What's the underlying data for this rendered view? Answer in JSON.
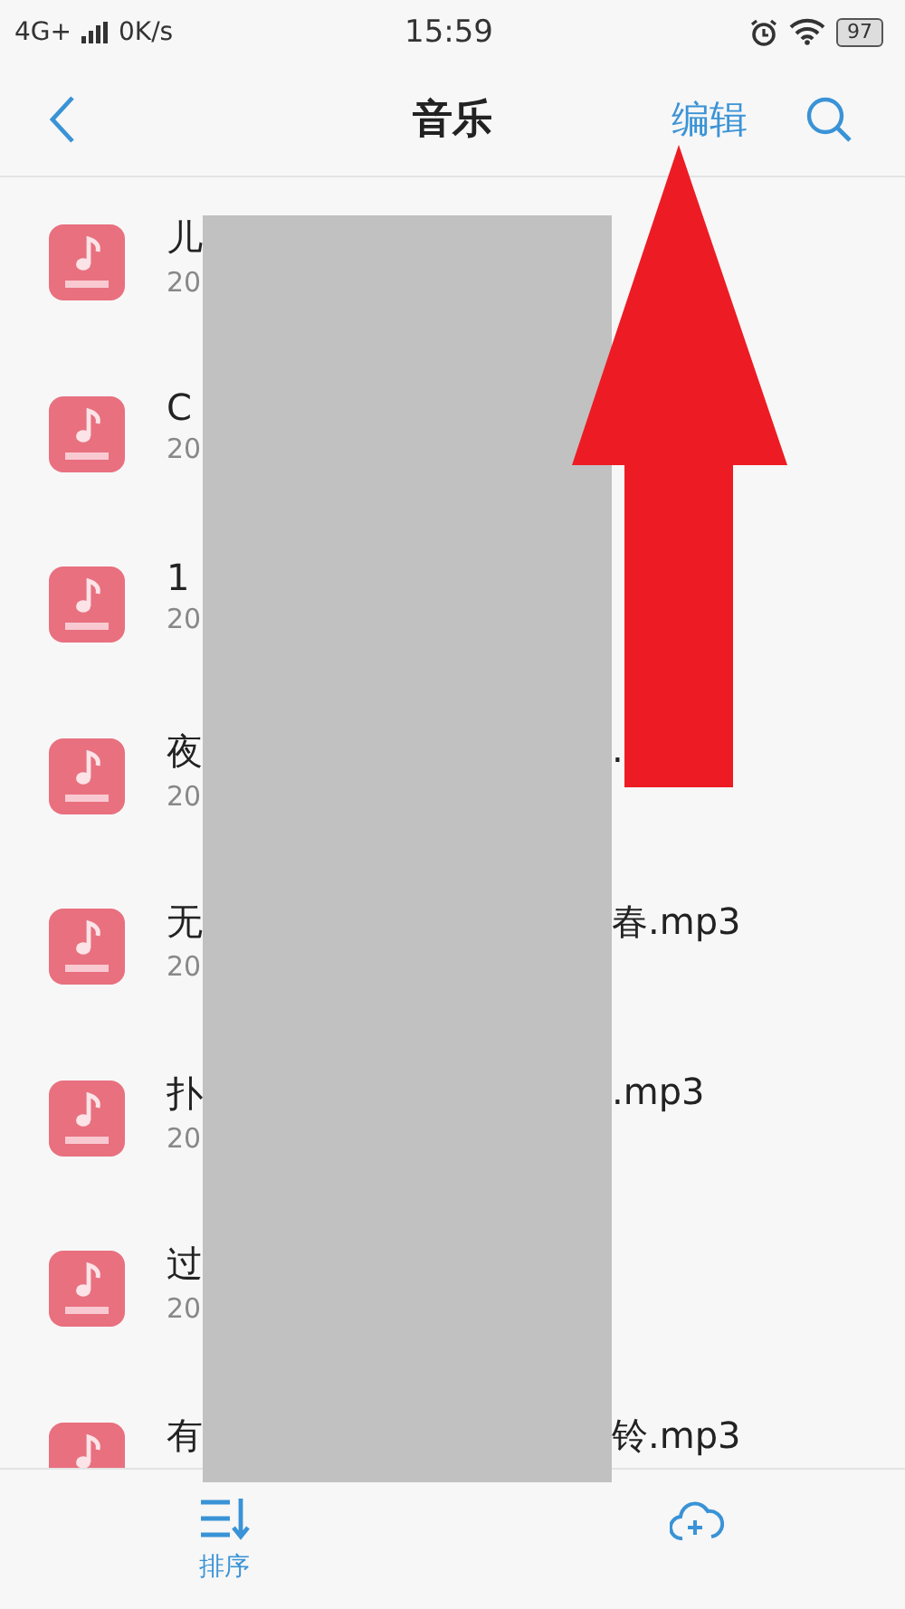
{
  "status_bar": {
    "network": "4G+",
    "speed": "0K/s",
    "time": "15:59",
    "battery": "97"
  },
  "header": {
    "title": "音乐",
    "edit": "编辑"
  },
  "songs": [
    {
      "title_start": "儿",
      "date": "20"
    },
    {
      "title_start": "C",
      "date": "20"
    },
    {
      "title_start": "1",
      "date": "20"
    },
    {
      "title_start": "夜",
      "title_end": ".",
      "date": "20"
    },
    {
      "title_start": "无",
      "title_end": "春.mp3",
      "date": "20"
    },
    {
      "title_start": "扑",
      "title_end": ".mp3",
      "date": "20"
    },
    {
      "title_start": "过",
      "date": "20"
    },
    {
      "title_start": "有",
      "title_end": "铃.mp3"
    }
  ],
  "bottom_bar": [
    {
      "kind": "sort",
      "label": "排序"
    },
    {
      "kind": "cloud"
    }
  ]
}
